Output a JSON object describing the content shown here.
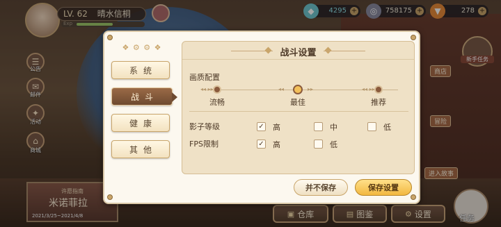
{
  "hud": {
    "level": "LV. 62",
    "player_name": "晴水信桐",
    "exp_label": "Exp",
    "exp_progress": 0.55,
    "gems": "4295",
    "coins": "758175",
    "carrots": "278",
    "plus": "+"
  },
  "side_menu": [
    {
      "label": "公告"
    },
    {
      "label": "邮件"
    },
    {
      "label": "活动"
    },
    {
      "label": "商城"
    }
  ],
  "banner": {
    "subtitle": "许愿指南",
    "title": "米诺菲拉",
    "dates": "2021/3/25~2021/4/8"
  },
  "right_menu": {
    "quest": "新手任务",
    "shop": "商店",
    "adventure": "冒险",
    "story": "进入故事"
  },
  "bottom_bar": {
    "warehouse": "仓库",
    "gallery": "图鉴",
    "settings": "设置",
    "tasks": "任务"
  },
  "settings_dialog": {
    "tabs": [
      {
        "label": "系统",
        "active": false
      },
      {
        "label": "战斗",
        "active": true
      },
      {
        "label": "健康",
        "active": false
      },
      {
        "label": "其他",
        "active": false
      }
    ],
    "panel_title": "战斗设置",
    "quality_label": "画质配置",
    "quality_options": [
      "流畅",
      "最佳",
      "推荐"
    ],
    "quality_selected": "最佳",
    "shadow_label": "影子等级",
    "shadow_options": [
      {
        "label": "高",
        "checked": true
      },
      {
        "label": "中",
        "checked": false
      },
      {
        "label": "低",
        "checked": false
      }
    ],
    "fps_label": "FPS限制",
    "fps_options": [
      {
        "label": "高",
        "checked": true
      },
      {
        "label": "低",
        "checked": false
      }
    ],
    "buttons": {
      "no_save": "并不保存",
      "save": "保存设置"
    },
    "check_mark": "✓"
  }
}
